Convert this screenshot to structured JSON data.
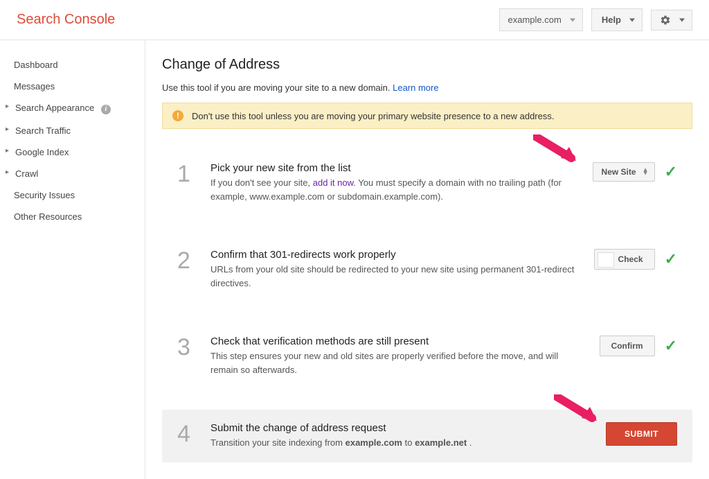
{
  "header": {
    "logo": "Search Console",
    "property": "example.com",
    "help_label": "Help"
  },
  "sidebar": {
    "items": [
      {
        "label": "Dashboard",
        "expandable": false
      },
      {
        "label": "Messages",
        "expandable": false
      },
      {
        "label": "Search Appearance",
        "expandable": true,
        "info": true
      },
      {
        "label": "Search Traffic",
        "expandable": true
      },
      {
        "label": "Google Index",
        "expandable": true
      },
      {
        "label": "Crawl",
        "expandable": true
      },
      {
        "label": "Security Issues",
        "expandable": false
      },
      {
        "label": "Other Resources",
        "expandable": false
      }
    ]
  },
  "main": {
    "title": "Change of Address",
    "subtitle_text": "Use this tool if you are moving your site to a new domain. ",
    "subtitle_link": "Learn more",
    "warning": "Don't use this tool unless you are moving your primary website presence to a new address.",
    "steps": [
      {
        "num": "1",
        "title": "Pick your new site from the list",
        "desc_before": "If you don't see your site, ",
        "desc_link": "add it now",
        "desc_after": ". You must specify a domain with no trailing path (for example, www.example.com or subdomain.example.com).",
        "action_type": "select",
        "action_label": "New Site",
        "check": true
      },
      {
        "num": "2",
        "title": "Confirm that 301-redirects work properly",
        "desc": "URLs from your old site should be redirected to your new site using permanent 301-redirect directives.",
        "action_type": "check_button",
        "action_label": "Check",
        "check": true
      },
      {
        "num": "3",
        "title": "Check that verification methods are still present",
        "desc": "This step ensures your new and old sites are properly verified before the move, and will remain so afterwards.",
        "action_type": "button",
        "action_label": "Confirm",
        "check": true
      },
      {
        "num": "4",
        "title": "Submit the change of address request",
        "desc_prefix": "Transition your site indexing from ",
        "desc_from": "example.com",
        "desc_mid": " to ",
        "desc_to": "example.net",
        "desc_suffix": " .",
        "action_type": "submit",
        "action_label": "SUBMIT",
        "highlighted": true
      }
    ]
  }
}
